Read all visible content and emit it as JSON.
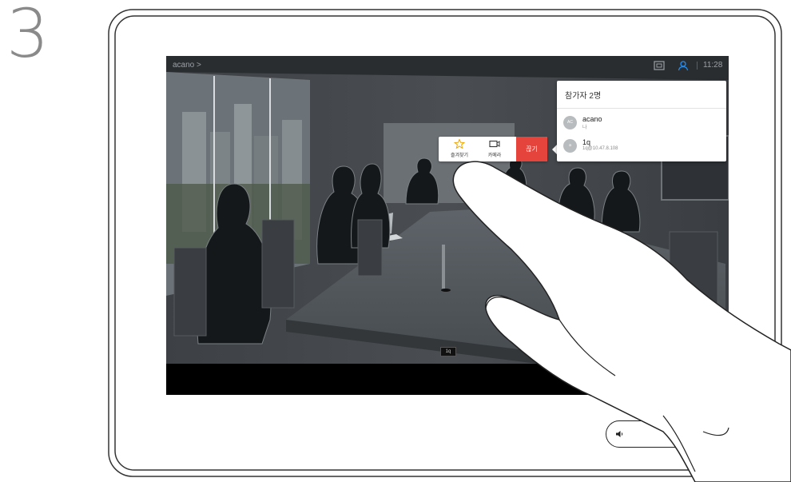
{
  "step": {
    "number": "3"
  },
  "call": {
    "name": "acano >",
    "time": "11:28"
  },
  "participants": {
    "title": "참가자 2명",
    "list": [
      {
        "initials": "AC",
        "name": "acano",
        "subtitle": "나"
      },
      {
        "initials": "a",
        "name": "1q",
        "subtitle": "1q@10.47.8.108"
      }
    ]
  },
  "actions": {
    "favorite_label": "즐겨찾기",
    "camera_label": "카메라",
    "end_label": "끊기"
  },
  "self_view": {
    "label": "1q"
  },
  "icons": {
    "layout": "layout-icon",
    "participants": "participants-icon",
    "favorite": "star-icon",
    "camera": "camera-icon",
    "volume_down": "volume-down-icon",
    "volume_up": "volume-up-icon"
  },
  "colors": {
    "end_call": "#e5443d",
    "accent": "#1e90ff"
  }
}
